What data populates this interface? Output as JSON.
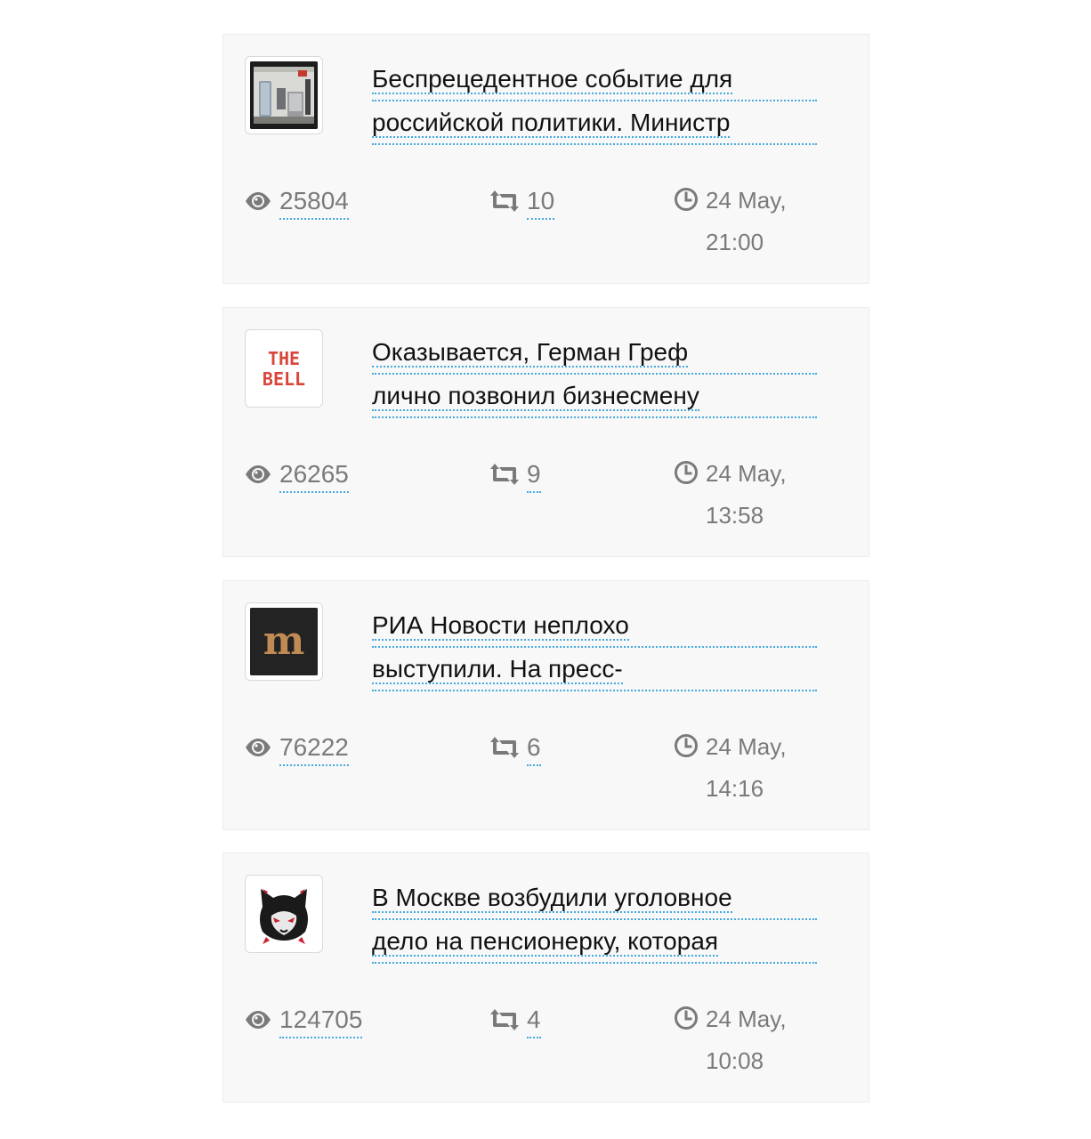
{
  "posts": [
    {
      "headline_line1": "Беспрецедентное событие для",
      "headline_line2": "российской политики. Министр",
      "views": "25804",
      "reposts": "10",
      "time_line1": "24 May,",
      "time_line2": "21:00",
      "thumbnail": "photo-thumbnail"
    },
    {
      "headline_line1": "Оказывается, Герман Греф",
      "headline_line2": "лично позвонил бизнесмену",
      "views": "26265",
      "reposts": "9",
      "time_line1": "24 May,",
      "time_line2": "13:58",
      "thumbnail": "the-bell-logo",
      "logo_text_1": "THE",
      "logo_text_2": "BELL",
      "logo_color": "#d9453a"
    },
    {
      "headline_line1": "РИА Новости неплохо",
      "headline_line2": "выступили. На пресс-",
      "views": "76222",
      "reposts": "6",
      "time_line1": "24 May,",
      "time_line2": "14:16",
      "thumbnail": "m-logo",
      "logo_text": "m",
      "logo_color": "#c08a55"
    },
    {
      "headline_line1": "В Москве возбудили уголовное",
      "headline_line2": "дело на пенсионерку, которая",
      "views": "124705",
      "reposts": "4",
      "time_line1": "24 May,",
      "time_line2": "10:08",
      "thumbnail": "hooded-cat-logo"
    }
  ],
  "icons": {
    "views": "eye-icon",
    "reposts": "retweet-icon",
    "time": "clock-icon"
  },
  "colors": {
    "link_underline": "#44a9df",
    "stat_text": "#7a7a7a",
    "card_bg": "#f8f8f8"
  }
}
